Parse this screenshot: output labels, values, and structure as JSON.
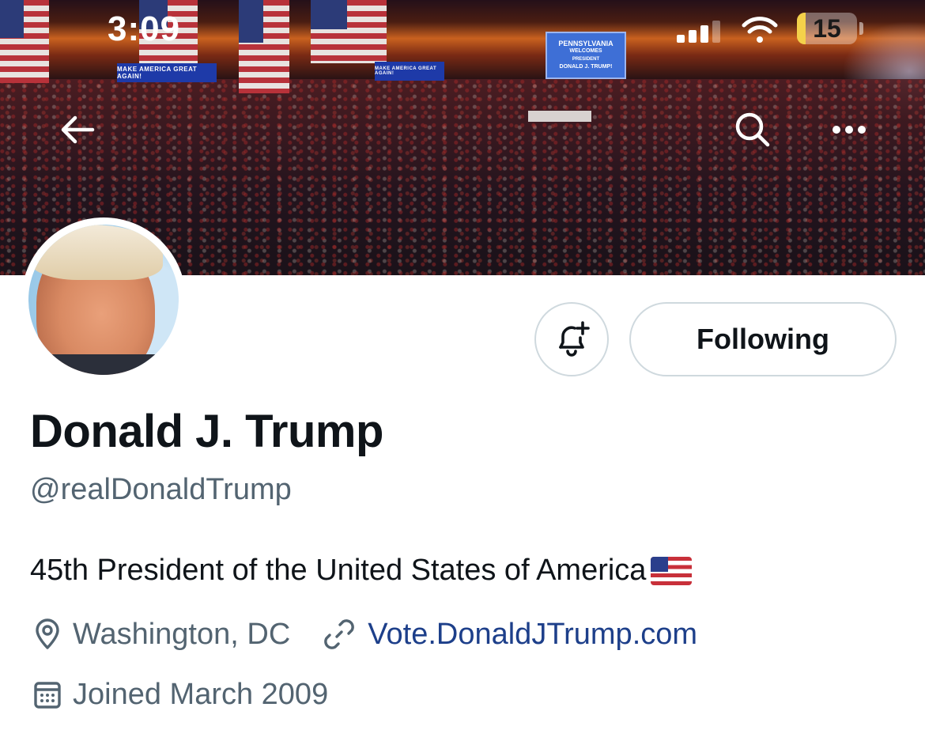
{
  "status_bar": {
    "time": "3:09",
    "battery": "15",
    "battery_level": 0.15
  },
  "banner": {
    "sign_maga_left": "MAKE AMERICA GREAT AGAIN!",
    "sign_maga_right": "MAKE AMERICA GREAT AGAIN!",
    "sign_pennsylvania": "PENNSYLVANIA",
    "sign_welcomes": "WELCOMES",
    "sign_president": "PRESIDENT",
    "sign_name": "DONALD J. TRUMP!"
  },
  "nav": {
    "back_icon": "arrow-left-icon",
    "search_icon": "search-icon",
    "more_icon": "more-horizontal-icon"
  },
  "actions": {
    "notify_icon": "bell-plus-icon",
    "following_label": "Following"
  },
  "profile": {
    "display_name": "Donald J. Trump",
    "handle": "@realDonaldTrump",
    "bio": "45th President of the United States of America",
    "bio_emoji": "us-flag-emoji",
    "location": "Washington, DC",
    "website": "Vote.DonaldJTrump.com",
    "joined": "Joined March 2009"
  },
  "colors": {
    "text_primary": "#0f1419",
    "text_secondary": "#536471",
    "link": "#1d3f8a",
    "border": "#cfd9de",
    "battery_fill": "#f4d14a"
  }
}
